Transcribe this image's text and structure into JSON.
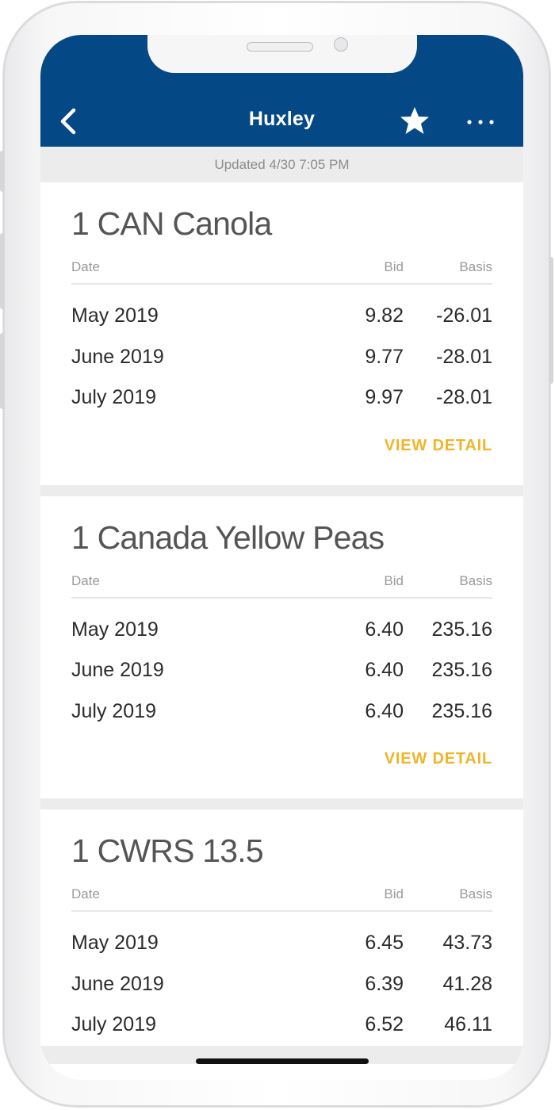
{
  "header": {
    "title": "Huxley",
    "back_icon": "chevron-left-icon",
    "favorite_icon": "star-icon",
    "more_icon": "more-horizontal-icon"
  },
  "updated_text": "Updated 4/30 7:05 PM",
  "columns": {
    "date": "Date",
    "bid": "Bid",
    "basis": "Basis"
  },
  "view_detail_label": "VIEW DETAIL",
  "colors": {
    "brand": "#044885",
    "accent": "#f0b429"
  },
  "commodities": [
    {
      "name": "1 CAN Canola",
      "rows": [
        {
          "date": "May 2019",
          "bid": "9.82",
          "basis": "-26.01"
        },
        {
          "date": "June 2019",
          "bid": "9.77",
          "basis": "-28.01"
        },
        {
          "date": "July 2019",
          "bid": "9.97",
          "basis": "-28.01"
        }
      ]
    },
    {
      "name": "1 Canada Yellow Peas",
      "rows": [
        {
          "date": "May 2019",
          "bid": "6.40",
          "basis": "235.16"
        },
        {
          "date": "June 2019",
          "bid": "6.40",
          "basis": "235.16"
        },
        {
          "date": "July 2019",
          "bid": "6.40",
          "basis": "235.16"
        }
      ]
    },
    {
      "name": "1 CWRS 13.5",
      "rows": [
        {
          "date": "May 2019",
          "bid": "6.45",
          "basis": "43.73"
        },
        {
          "date": "June 2019",
          "bid": "6.39",
          "basis": "41.28"
        },
        {
          "date": "July 2019",
          "bid": "6.52",
          "basis": "46.11"
        }
      ]
    }
  ]
}
